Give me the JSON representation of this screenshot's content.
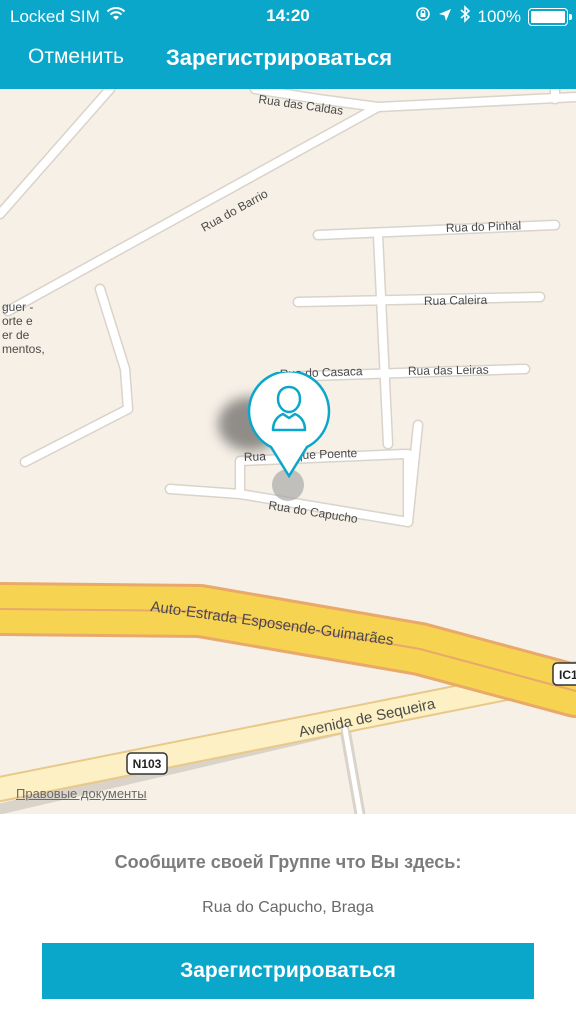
{
  "status_bar": {
    "carrier": "Locked SIM",
    "time": "14:20",
    "battery": "100%",
    "battery_level": 1.0,
    "icons": [
      "wifi-icon",
      "rotation-lock-icon",
      "location-arrow-icon",
      "bluetooth-icon",
      "battery-icon"
    ]
  },
  "nav": {
    "cancel_label": "Отменить",
    "title": "Зарегистрироваться"
  },
  "map": {
    "street_labels": {
      "rua_das_caldas": "Rua das Caldas",
      "rua_do_barrio": "Rua do Barrio",
      "rua_do_pinhal": "Rua do Pinhal",
      "rua_caleira": "Rua Caleira",
      "rua_do_casaca": "Rua do Casaca",
      "rua_das_leiras": "Rua das Leiras",
      "rua_que_poente": "Rua         que Poente",
      "rua_do_capucho": "Rua do Capucho",
      "autoestrada": "Auto-Estrada Esposende-Guimarães",
      "avenida": "Avenida de Sequeira",
      "shield_n103": "N103",
      "shield_ic1": "IC1",
      "poi_line1": "guer -",
      "poi_line2": "orte e",
      "poi_line3": "er de",
      "poi_line4": "mentos,"
    },
    "legal_link": "Правовые документы",
    "pin_icon": "person-icon"
  },
  "panel": {
    "prompt": "Сообщите своей Группе что Вы здесь:",
    "address": "Rua do Capucho, Braga",
    "register_button": "Зарегистрироваться"
  },
  "colors": {
    "accent": "#0aa7cb",
    "map_background": "#f6f0e7",
    "highway": "#f7d352",
    "highway_border": "#e8a96b"
  }
}
